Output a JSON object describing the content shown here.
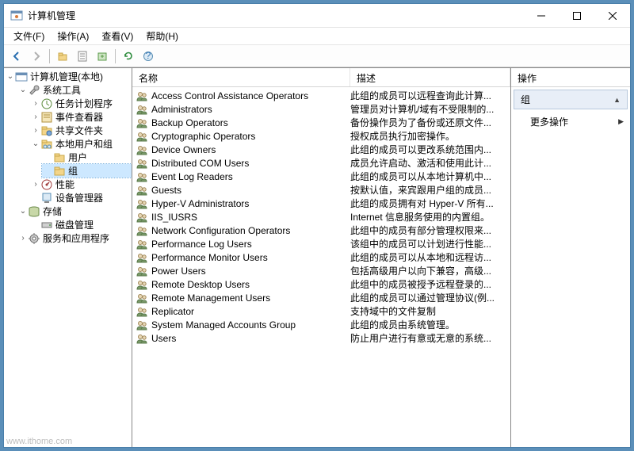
{
  "window": {
    "title": "计算机管理"
  },
  "menu": {
    "file": "文件(F)",
    "action": "操作(A)",
    "view": "查看(V)",
    "help": "帮助(H)"
  },
  "tree": {
    "root": "计算机管理(本地)",
    "system_tools": "系统工具",
    "task_scheduler": "任务计划程序",
    "event_viewer": "事件查看器",
    "shared_folders": "共享文件夹",
    "local_users_groups": "本地用户和组",
    "users": "用户",
    "groups": "组",
    "performance": "性能",
    "device_manager": "设备管理器",
    "storage": "存储",
    "disk_management": "磁盘管理",
    "services_apps": "服务和应用程序"
  },
  "list_headers": {
    "name": "名称",
    "description": "描述"
  },
  "groups": [
    {
      "name": "Access Control Assistance Operators",
      "desc": "此组的成员可以远程查询此计算..."
    },
    {
      "name": "Administrators",
      "desc": "管理员对计算机/域有不受限制的..."
    },
    {
      "name": "Backup Operators",
      "desc": "备份操作员为了备份或还原文件..."
    },
    {
      "name": "Cryptographic Operators",
      "desc": "授权成员执行加密操作。"
    },
    {
      "name": "Device Owners",
      "desc": "此组的成员可以更改系统范围内..."
    },
    {
      "name": "Distributed COM Users",
      "desc": "成员允许启动、激活和使用此计..."
    },
    {
      "name": "Event Log Readers",
      "desc": "此组的成员可以从本地计算机中..."
    },
    {
      "name": "Guests",
      "desc": "按默认值，来宾跟用户组的成员..."
    },
    {
      "name": "Hyper-V Administrators",
      "desc": "此组的成员拥有对 Hyper-V 所有..."
    },
    {
      "name": "IIS_IUSRS",
      "desc": "Internet 信息服务使用的内置组。"
    },
    {
      "name": "Network Configuration Operators",
      "desc": "此组中的成员有部分管理权限来..."
    },
    {
      "name": "Performance Log Users",
      "desc": "该组中的成员可以计划进行性能..."
    },
    {
      "name": "Performance Monitor Users",
      "desc": "此组的成员可以从本地和远程访..."
    },
    {
      "name": "Power Users",
      "desc": "包括高级用户以向下兼容，高级..."
    },
    {
      "name": "Remote Desktop Users",
      "desc": "此组中的成员被授予远程登录的..."
    },
    {
      "name": "Remote Management Users",
      "desc": "此组的成员可以通过管理协议(例..."
    },
    {
      "name": "Replicator",
      "desc": "支持域中的文件复制"
    },
    {
      "name": "System Managed Accounts Group",
      "desc": "此组的成员由系统管理。"
    },
    {
      "name": "Users",
      "desc": "防止用户进行有意或无意的系统..."
    }
  ],
  "actions": {
    "header": "操作",
    "section": "组",
    "more": "更多操作"
  },
  "watermark": "www.ithome.com"
}
